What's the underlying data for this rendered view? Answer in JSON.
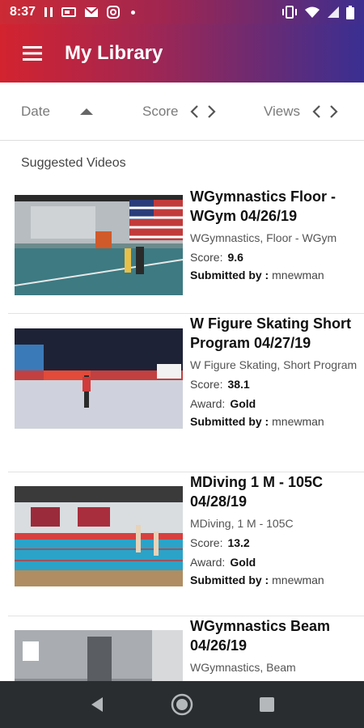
{
  "status_bar": {
    "time": "8:37"
  },
  "app_bar": {
    "title": "My Library"
  },
  "sort_bar": {
    "date_label": "Date",
    "score_label": "Score",
    "views_label": "Views"
  },
  "section_title": "Suggested Videos",
  "videos": [
    {
      "title": "WGymnastics Floor - WGym 04/26/19",
      "subtitle": "WGymnastics, Floor - WGym",
      "score_label": "Score:",
      "score": "9.6",
      "submitted_label": "Submitted by :",
      "submitted_by": "mnewman"
    },
    {
      "title": "W Figure Skating Short Program 04/27/19",
      "subtitle": "W Figure Skating, Short Program",
      "score_label": "Score:",
      "score": "38.1",
      "award_label": "Award:",
      "award": "Gold",
      "submitted_label": "Submitted by :",
      "submitted_by": "mnewman"
    },
    {
      "title": "MDiving 1 M - 105C 04/28/19",
      "subtitle": "MDiving, 1 M - 105C",
      "score_label": "Score:",
      "score": "13.2",
      "award_label": "Award:",
      "award": "Gold",
      "submitted_label": "Submitted by :",
      "submitted_by": "mnewman"
    },
    {
      "title": "WGymnastics Beam 04/26/19",
      "subtitle": "WGymnastics, Beam"
    }
  ],
  "colors": {
    "bar_start": "#d3232f",
    "bar_end": "#392f92",
    "nav_bg": "#2a2d30"
  }
}
